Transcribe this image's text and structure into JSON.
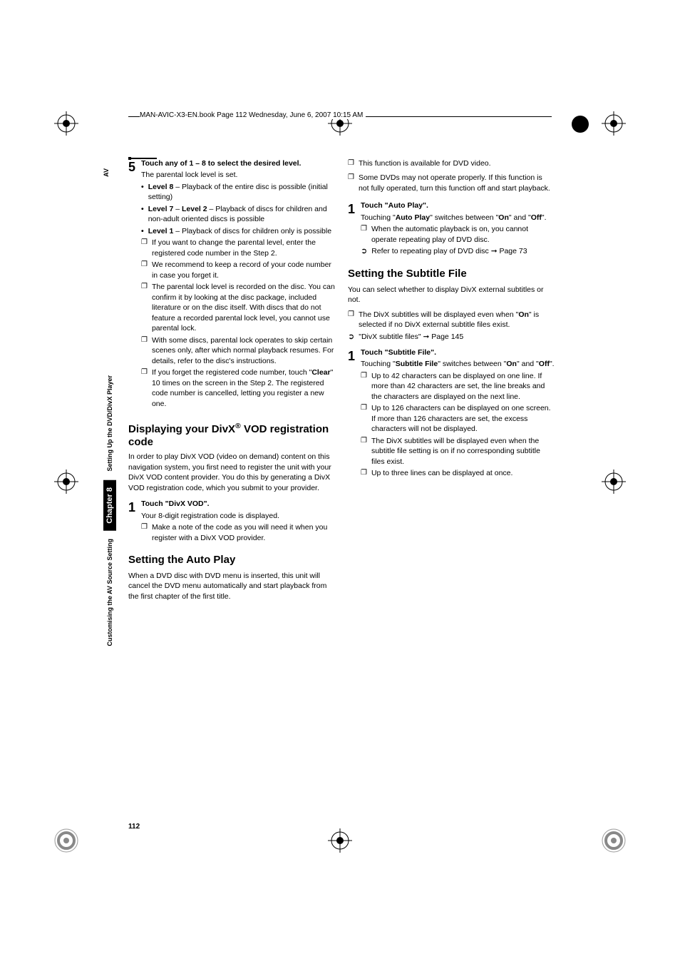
{
  "header": "MAN-AVIC-X3-EN.book  Page 112  Wednesday, June 6, 2007  10:15 AM",
  "side": {
    "av": "AV",
    "label1": "Setting Up the DVD/DivX Player",
    "chapter": "Chapter 8",
    "label2": "Customising the AV Source Setting"
  },
  "col1": {
    "step5": {
      "num": "5",
      "title": "Touch any of 1 – 8 to select the desired level.",
      "p1": "The parental lock level is set.",
      "b1a": "Level 8",
      "b1b": " – Playback of the entire disc is possible (initial setting)",
      "b2a": "Level 7",
      "b2mid": " – ",
      "b2b": "Level 2",
      "b2c": " – Playback of discs for children and non-adult oriented discs is possible",
      "b3a": "Level 1",
      "b3b": " – Playback of discs for children only is possible",
      "n1": "If you want to change the parental level, enter the registered code number in the Step 2.",
      "n2": "We recommend to keep a record of your code number in case you forget it.",
      "n3": "The parental lock level is recorded on the disc. You can confirm it by looking at the disc package, included literature or on the disc itself. With discs that do not feature a recorded parental lock level, you cannot use parental lock.",
      "n4": "With some discs, parental lock operates to skip certain scenes only, after which normal playback resumes. For details, refer to the disc's instructions.",
      "n5a": "If you forget the registered code number, touch \"",
      "n5b": "Clear",
      "n5c": "\" 10 times on the screen in the Step 2. The registered code number is cancelled, letting you register a new one."
    },
    "divx": {
      "title_a": "Displaying your DivX",
      "title_sup": "®",
      "title_b": " VOD registration code",
      "intro": "In order to play DivX VOD (video on demand) content on this navigation system, you first need to register the unit with your DivX VOD content provider. You do this by generating a DivX VOD registration code, which you submit to your provider.",
      "step1_num": "1",
      "step1_title": "Touch \"DivX VOD\".",
      "step1_p": "Your 8-digit registration code is displayed.",
      "step1_n": "Make a note of the code as you will need it when you register with a DivX VOD provider."
    },
    "autoplay": {
      "title": "Setting the Auto Play",
      "intro": "When a DVD disc with DVD menu is inserted, this unit will cancel the DVD menu automatically and start playback from the first chapter of the first title."
    }
  },
  "col2": {
    "pre_notes": {
      "n1": "This function is available for DVD video.",
      "n2": "Some DVDs may not operate properly. If this function is not fully operated, turn this function off and start playback."
    },
    "autoplay_step": {
      "num": "1",
      "title": "Touch \"Auto Play\".",
      "p_a": "Touching \"",
      "p_b": "Auto Play",
      "p_c": "\" switches between \"",
      "p_d": "On",
      "p_e": "\" and \"",
      "p_f": "Off",
      "p_g": "\".",
      "n1": "When the automatic playback is on, you cannot operate repeating play of DVD disc.",
      "r1a": "Refer to repeating play of DVD disc ",
      "r1b": "➞",
      "r1c": " Page 73"
    },
    "subtitle": {
      "title": "Setting the Subtitle File",
      "intro": "You can select whether to display DivX external subtitles or not.",
      "n1a": "The DivX subtitles will be displayed even when \"",
      "n1b": "On",
      "n1c": "\" is selected if no DivX external subtitle files exist.",
      "r1": "\"DivX subtitle files\" ➞ Page 145",
      "step_num": "1",
      "step_title": "Touch \"Subtitle File\".",
      "p_a": "Touching \"",
      "p_b": "Subtitle File",
      "p_c": "\" switches between \"",
      "p_d": "On",
      "p_e": "\" and \"",
      "p_f": "Off",
      "p_g": "\".",
      "sn1": "Up to 42 characters can be displayed on one line. If more than 42 characters are set, the line breaks and the characters are displayed on the next line.",
      "sn2": "Up to 126 characters can be displayed on one screen. If more than 126 characters are set, the excess characters will not be displayed.",
      "sn3": "The DivX subtitles will be displayed even when the subtitle file setting is on if no corresponding subtitle files exist.",
      "sn4": "Up to three lines can be displayed at once."
    }
  },
  "pagenum": "112"
}
